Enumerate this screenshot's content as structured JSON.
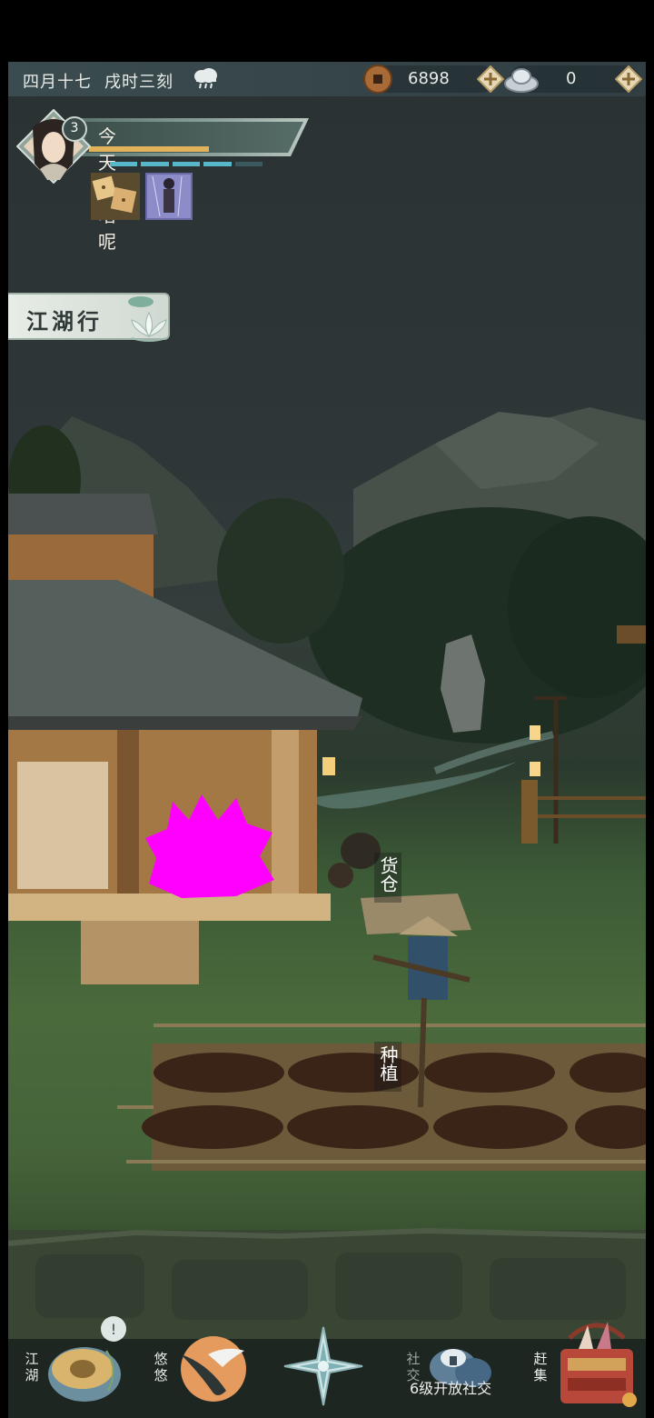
{
  "topbar": {
    "date": "四月十七",
    "time": "戌时三刻",
    "weather_icon": "rain-cloud-icon",
    "coin_value": "6898",
    "silver_value": "0"
  },
  "player": {
    "level": "3",
    "name": "今天吃啥呢",
    "energy_segments_filled": 4,
    "energy_segments_total": 5
  },
  "buttons": {
    "jianghu": "江湖行"
  },
  "scene_labels": {
    "storage": "货仓",
    "planting": "种植"
  },
  "bottom_nav": {
    "jianghu": "江湖",
    "youyou": "悠悠",
    "social": "社交",
    "social_unlock": "6级开放社交",
    "market": "赶集"
  }
}
